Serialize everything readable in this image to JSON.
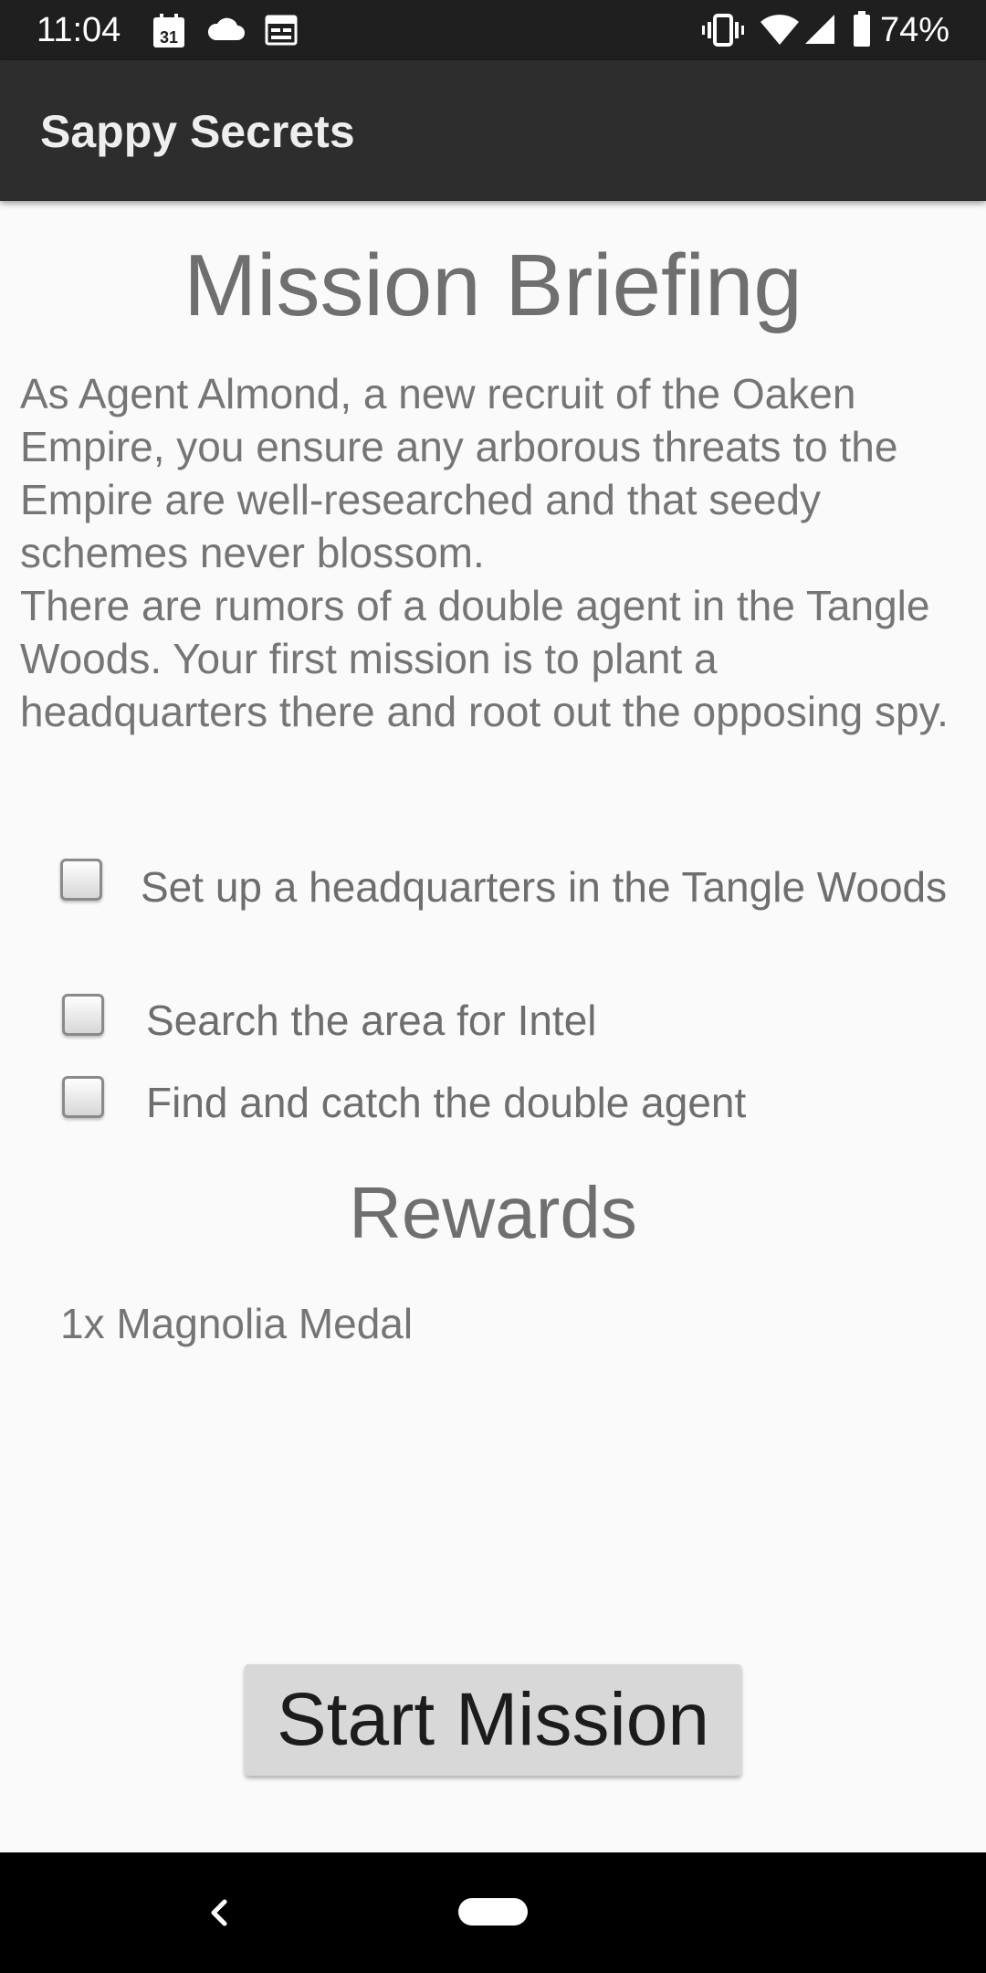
{
  "status_bar": {
    "time": "11:04",
    "calendar_day": "31",
    "battery": "74%",
    "icons": [
      "calendar-icon",
      "cloud-icon",
      "news-icon",
      "vibrate-icon",
      "wifi-icon",
      "signal-icon",
      "battery-icon"
    ]
  },
  "app_bar": {
    "title": "Sappy Secrets"
  },
  "briefing": {
    "title": "Mission Briefing",
    "paragraph_1": "As Agent Almond, a new recruit of the Oaken Empire, you ensure any arborous threats to the Empire are well-researched and that seedy schemes never blossom.",
    "paragraph_2": "There are rumors of a double agent in the Tangle Woods. Your first mission is to plant a headquarters there and root out the opposing spy."
  },
  "tasks": [
    {
      "label": "Set up a headquarters in the Tangle Woods",
      "checked": false
    },
    {
      "label": "Search the area for Intel",
      "checked": false
    },
    {
      "label": "Find and catch the double agent",
      "checked": false
    }
  ],
  "rewards": {
    "title": "Rewards",
    "items": [
      "1x Magnolia Medal"
    ]
  },
  "start_button": {
    "label": "Start Mission"
  },
  "colors": {
    "status_bar": "#1f1f1f",
    "app_bar": "#2d2d2d",
    "background": "#fafafa",
    "text": "#757575",
    "button": "#d8d8d8"
  }
}
